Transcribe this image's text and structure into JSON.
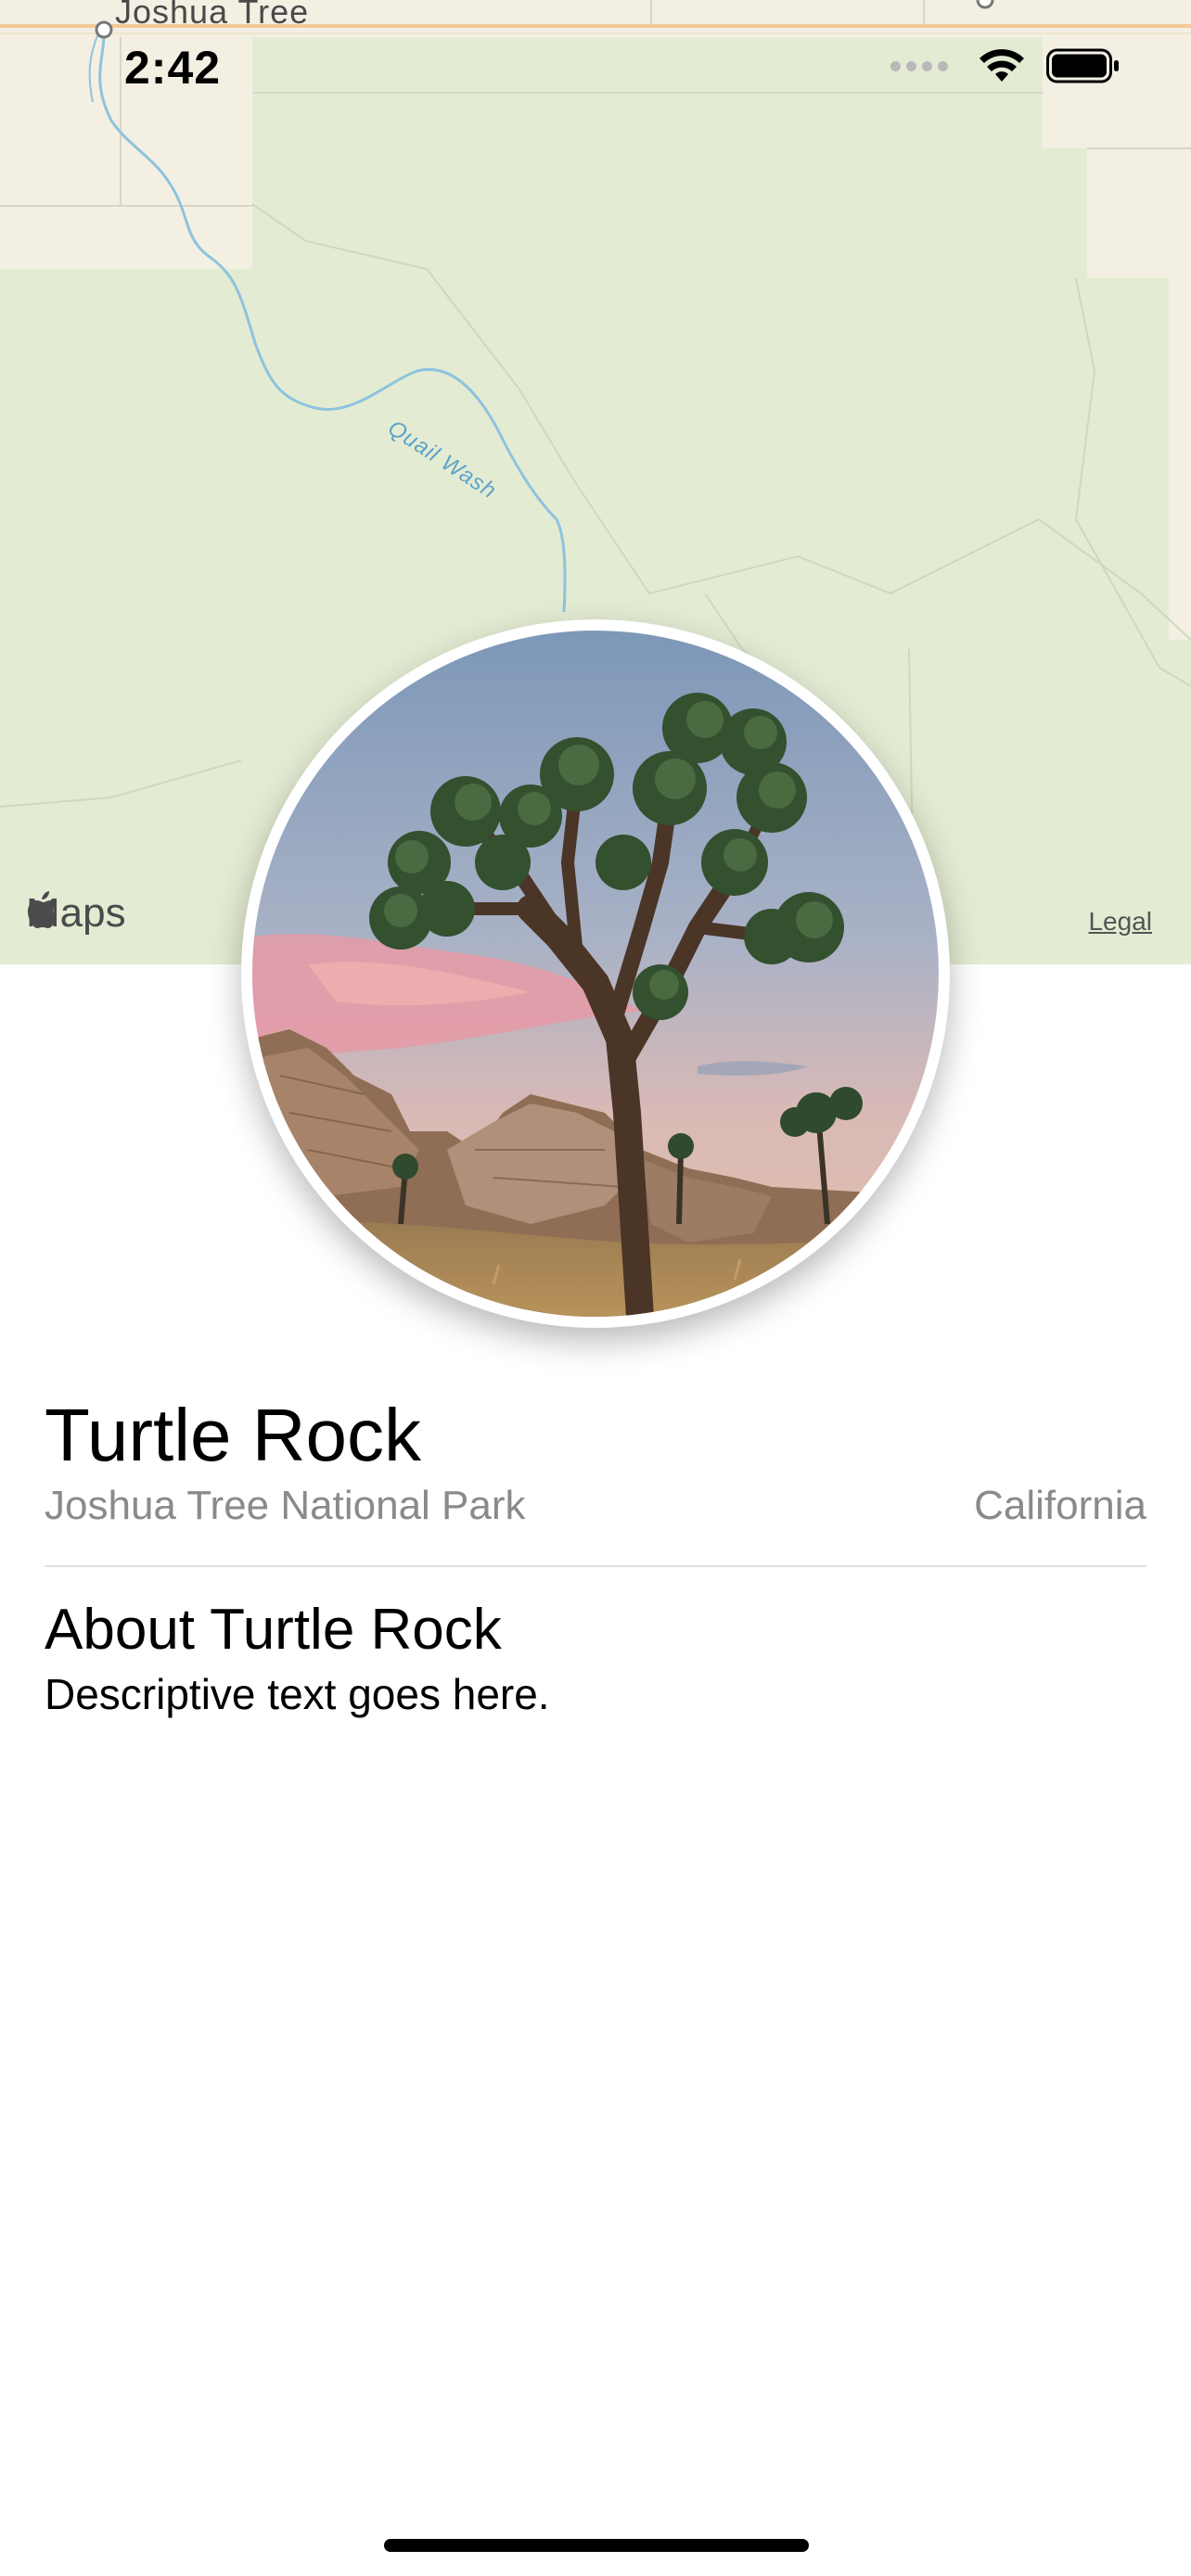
{
  "status_bar": {
    "time": "2:42",
    "icons": [
      "cellular-dots-icon",
      "wifi-icon",
      "battery-icon"
    ]
  },
  "map": {
    "town_label": "Joshua Tree",
    "wash_label": "Quail Wash",
    "brand": "Maps",
    "legal": "Legal",
    "colors": {
      "park": "#e3ecd3",
      "land": "#f3f0e3",
      "water": "#8ec3de",
      "road": "#f2c998"
    }
  },
  "landmark": {
    "image_icon": "joshua-tree-photo",
    "name": "Turtle Rock",
    "park": "Joshua Tree National Park",
    "state": "California",
    "about_heading": "About Turtle Rock",
    "description": "Descriptive text goes here."
  }
}
